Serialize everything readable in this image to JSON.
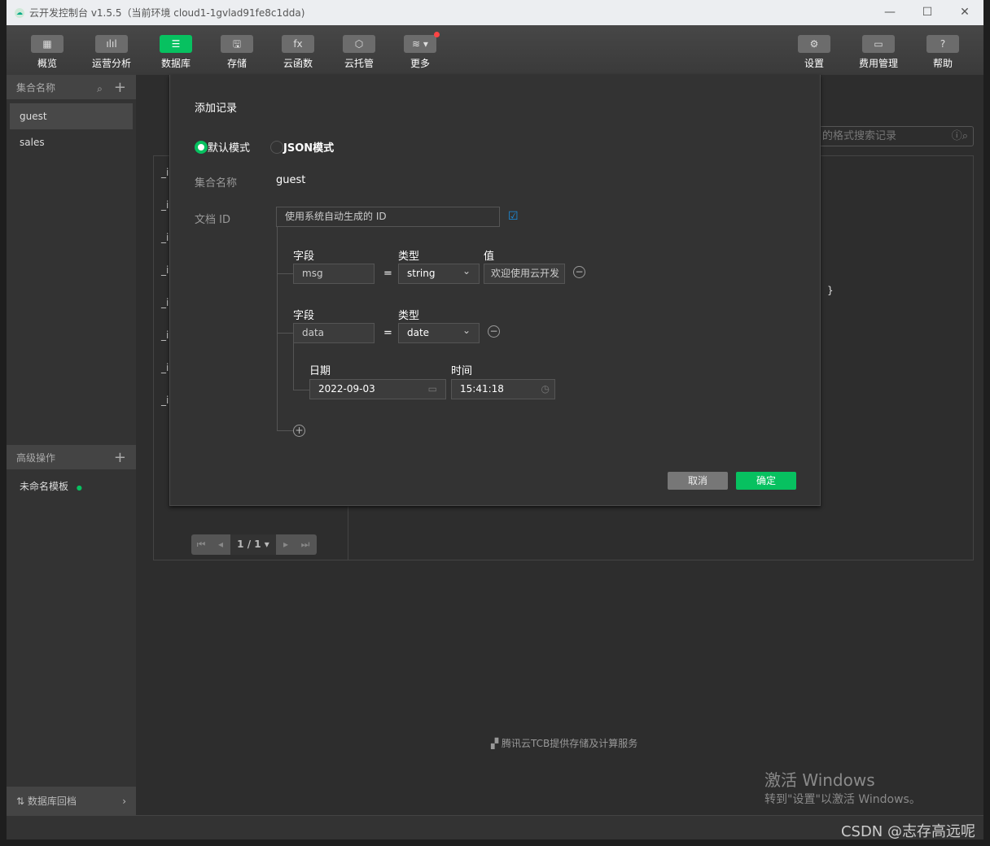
{
  "window": {
    "title": "云开发控制台 v1.5.5（当前环境 cloud1-1gvlad91fe8c1dda)",
    "minimize": "—",
    "maximize": "☐",
    "close": "✕"
  },
  "toolbar": {
    "left": [
      {
        "label": "概览",
        "icon": "grid-icon",
        "glyph": "▦"
      },
      {
        "label": "运营分析",
        "icon": "bar-chart-icon",
        "glyph": "ılıl"
      },
      {
        "label": "数据库",
        "icon": "database-icon",
        "glyph": "☰",
        "active": true
      },
      {
        "label": "存储",
        "icon": "save-icon",
        "glyph": "🖫"
      },
      {
        "label": "云函数",
        "icon": "function-icon",
        "glyph": "fx"
      },
      {
        "label": "云托管",
        "icon": "cube-icon",
        "glyph": "⬡"
      },
      {
        "label": "更多",
        "icon": "layers-icon",
        "glyph": "≋ ▾",
        "badge": true
      }
    ],
    "right": [
      {
        "label": "设置",
        "icon": "gear-icon",
        "glyph": "⚙"
      },
      {
        "label": "费用管理",
        "icon": "ticket-icon",
        "glyph": "▭"
      },
      {
        "label": "帮助",
        "icon": "help-icon",
        "glyph": "?"
      }
    ]
  },
  "sidebar": {
    "collections_header": "集合名称",
    "collections": [
      "guest",
      "sales"
    ],
    "advanced_header": "高级操作",
    "advanced_items": [
      "未命名模板"
    ],
    "rollback": "数据库回档"
  },
  "main": {
    "search_placeholder": "alue 的格式搜索记录",
    "row_prefix": "_i",
    "brace": "}",
    "pagination": "1 / 1",
    "footer": "腾讯云TCB提供存储及计算服务"
  },
  "modal": {
    "title": "添加记录",
    "modes": [
      "默认模式",
      "JSON模式"
    ],
    "selected_mode": "默认模式",
    "collection_label": "集合名称",
    "collection_value": "guest",
    "docid_label": "文档 ID",
    "docid_placeholder": "使用系统自动生成的 ID",
    "fields": [
      {
        "field_label": "字段",
        "type_label": "类型",
        "value_label": "值",
        "name": "msg",
        "type": "string",
        "value": "欢迎使用云开发"
      },
      {
        "field_label": "字段",
        "type_label": "类型",
        "name": "data",
        "type": "date",
        "date_label": "日期",
        "date": "2022-09-03",
        "time_label": "时间",
        "time": "15:41:18"
      }
    ],
    "equals": "=",
    "cancel": "取消",
    "confirm": "确定"
  },
  "watermark": {
    "line1": "激活 Windows",
    "line2": "转到\"设置\"以激活 Windows。",
    "csdn": "CSDN @志存高远呢"
  },
  "colors": {
    "accent": "#07c160",
    "badge": "#ff4444",
    "link": "#1a8ee0"
  }
}
